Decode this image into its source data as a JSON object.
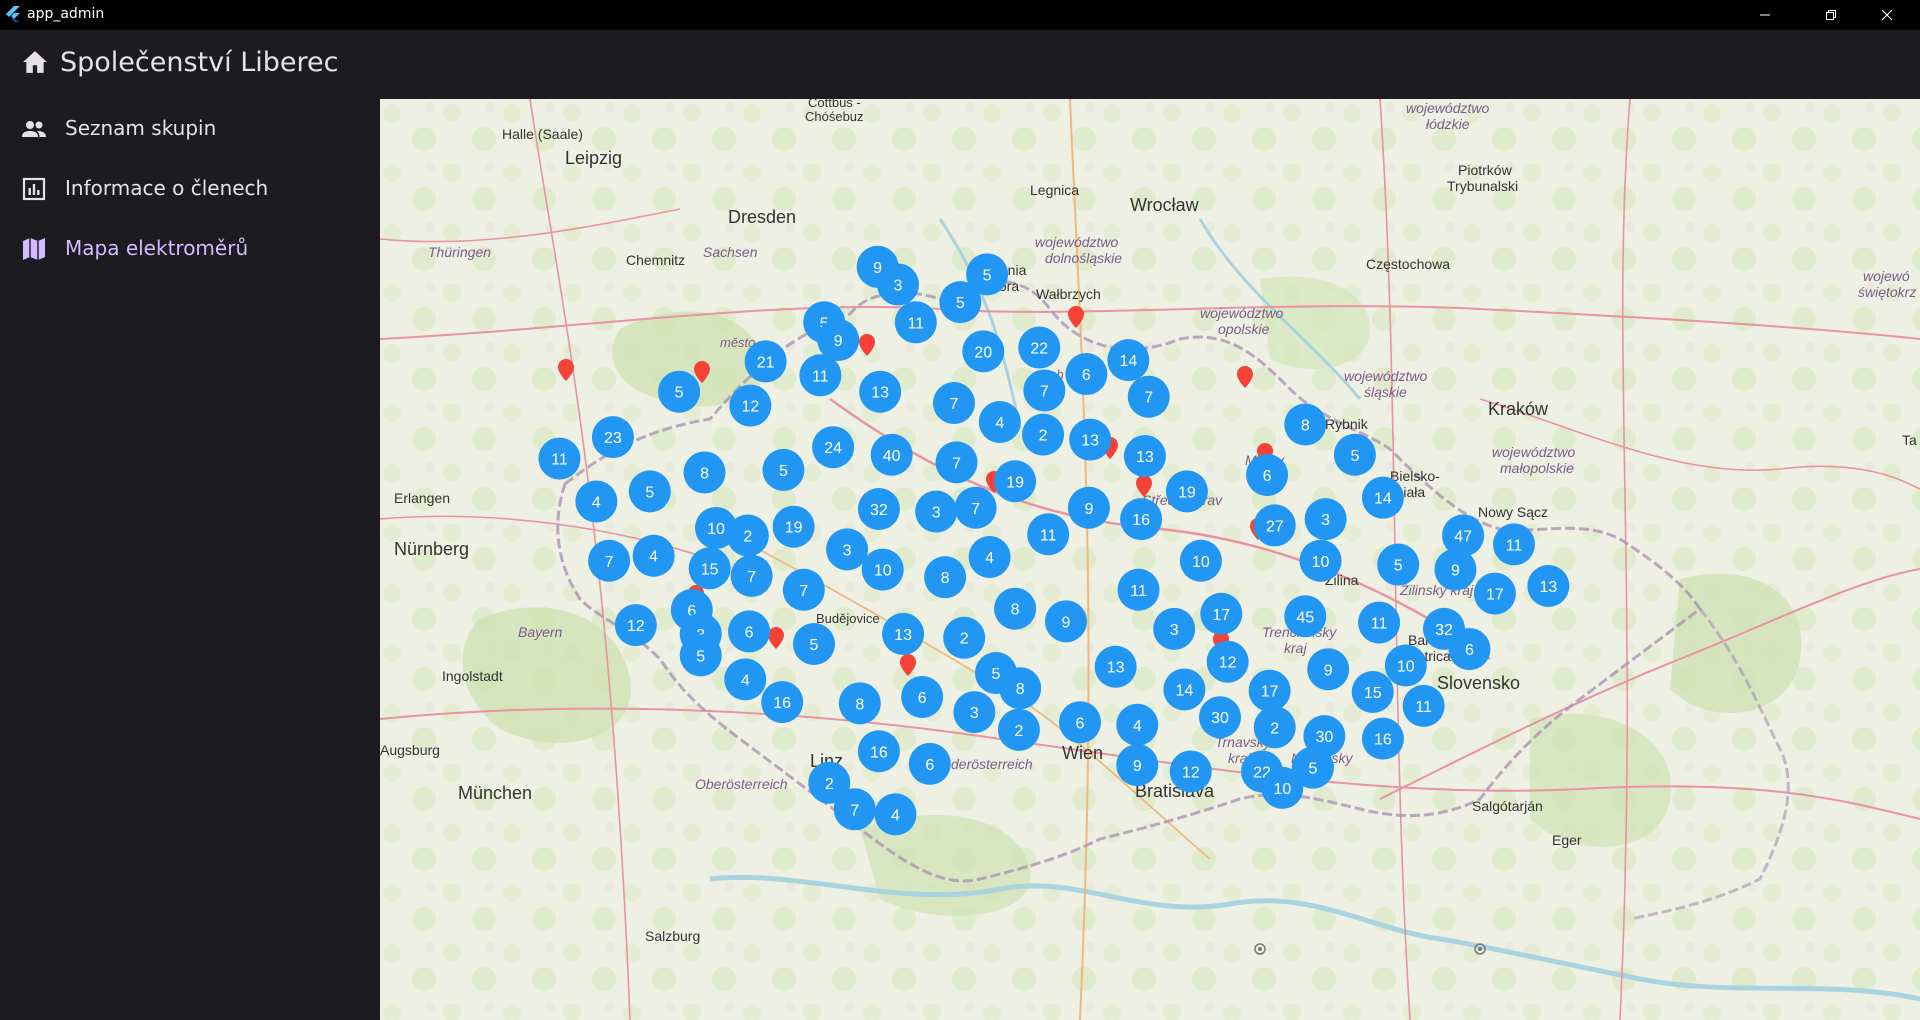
{
  "window": {
    "title": "app_admin",
    "controls": [
      "minimize-icon",
      "restore-icon",
      "close-icon"
    ]
  },
  "appbar": {
    "title": "Společenství Liberec",
    "icon": "home-icon"
  },
  "sidebar": {
    "items": [
      {
        "label": "Seznam skupin",
        "icon": "people-icon",
        "active": false
      },
      {
        "label": "Informace o členech",
        "icon": "bar-chart-icon",
        "active": false
      },
      {
        "label": "Mapa elektroměrů",
        "icon": "map-icon",
        "active": true
      }
    ]
  },
  "colors": {
    "accent": "#d0bcff",
    "cluster": "#2196f3",
    "marker": "#f44336",
    "background": "#1c1b1f"
  },
  "map": {
    "labels": {
      "halle": "Halle (Saale)",
      "leipzig": "Leipzig",
      "cottbus": "Cottbus -",
      "chosebuz": "Chóśebuz",
      "dresden": "Dresden",
      "sachsen": "Sachsen",
      "chemnitz": "Chemnitz",
      "thuringen": "Thüringen",
      "erlangen": "Erlangen",
      "nurnberg": "Nürnberg",
      "bayern": "Bayern",
      "ingolstadt": "Ingolstadt",
      "augsburg": "Augsburg",
      "munchen": "München",
      "salzburg": "Salzburg",
      "linz": "Linz",
      "oberosterreich": "Oberösterreich",
      "niederosterreich": "Niederösterreich",
      "wien": "Wien",
      "bratislava": "Bratislava",
      "legnica": "Legnica",
      "wroclaw": "Wrocław",
      "wojdolno1": "województwo",
      "wojdolno2": "dolnośląskie",
      "jelenia": "Jelenia",
      "gora": "Góra",
      "walbrzych": "Wałbrzych",
      "wojopol1": "województwo",
      "wojopol2": "opolskie",
      "wojslask1": "województwo",
      "wojslask2": "śląskie",
      "czestochowa": "Częstochowa",
      "piotrkow1": "Piotrków",
      "piotrkow2": "Trybunalski",
      "wojlodz1": "województwo",
      "wojlodz2": "łódzkie",
      "wojswiet1": "wojewó",
      "wojswiet2": "świętokrz",
      "krakow": "Kraków",
      "rybnik": "Rybnik",
      "wojmalo1": "województwo",
      "wojmalo2": "małopolskie",
      "bielsko1": "Bielsko-",
      "bielsko2": "Biała",
      "ta": "Ta",
      "nowysacz": "Nowy Sącz",
      "zilina": "Žilina",
      "zilinsky": "Žilinský kraj",
      "trencin1": "Trenčiansky",
      "trencin2": "kraj",
      "banska1": "Banská",
      "banska2": "Bystrica",
      "slovensko": "Slovensko",
      "trnava1": "Trnavský",
      "trnava2": "kraj",
      "nitra1": "Nitriansky",
      "nitra2": "kraj",
      "salgotarjan": "Salgótarján",
      "eger": "Eger",
      "stredomor": "Středomorav",
      "morav": "Morav",
      "budejovice": "Budějovice",
      "mesto": "město",
      "ch": "ch"
    },
    "clusters": [
      {
        "count": "9"
      },
      {
        "count": "3"
      },
      {
        "count": "5"
      },
      {
        "count": "5"
      },
      {
        "count": "11"
      },
      {
        "count": "5"
      },
      {
        "count": "9"
      },
      {
        "count": "21"
      },
      {
        "count": "11"
      },
      {
        "count": "20"
      },
      {
        "count": "22"
      },
      {
        "count": "14"
      },
      {
        "count": "6"
      },
      {
        "count": "7"
      },
      {
        "count": "7"
      },
      {
        "count": "13"
      },
      {
        "count": "5"
      },
      {
        "count": "12"
      },
      {
        "count": "7"
      },
      {
        "count": "4"
      },
      {
        "count": "2"
      },
      {
        "count": "13"
      },
      {
        "count": "23"
      },
      {
        "count": "11"
      },
      {
        "count": "24"
      },
      {
        "count": "40"
      },
      {
        "count": "5"
      },
      {
        "count": "8"
      },
      {
        "count": "5"
      },
      {
        "count": "4"
      },
      {
        "count": "7"
      },
      {
        "count": "19"
      },
      {
        "count": "13"
      },
      {
        "count": "8"
      },
      {
        "count": "5"
      },
      {
        "count": "32"
      },
      {
        "count": "3"
      },
      {
        "count": "7"
      },
      {
        "count": "10"
      },
      {
        "count": "2"
      },
      {
        "count": "19"
      },
      {
        "count": "9"
      },
      {
        "count": "16"
      },
      {
        "count": "19"
      },
      {
        "count": "6"
      },
      {
        "count": "14"
      },
      {
        "count": "7"
      },
      {
        "count": "4"
      },
      {
        "count": "15"
      },
      {
        "count": "7"
      },
      {
        "count": "3"
      },
      {
        "count": "10"
      },
      {
        "count": "8"
      },
      {
        "count": "4"
      },
      {
        "count": "11"
      },
      {
        "count": "27"
      },
      {
        "count": "3"
      },
      {
        "count": "10"
      },
      {
        "count": "5"
      },
      {
        "count": "47"
      },
      {
        "count": "11"
      },
      {
        "count": "9"
      },
      {
        "count": "17"
      },
      {
        "count": "13"
      },
      {
        "count": "6"
      },
      {
        "count": "7"
      },
      {
        "count": "12"
      },
      {
        "count": "6"
      },
      {
        "count": "3"
      },
      {
        "count": "5"
      },
      {
        "count": "13"
      },
      {
        "count": "2"
      },
      {
        "count": "8"
      },
      {
        "count": "9"
      },
      {
        "count": "11"
      },
      {
        "count": "10"
      },
      {
        "count": "45"
      },
      {
        "count": "17"
      },
      {
        "count": "3"
      },
      {
        "count": "11"
      },
      {
        "count": "32"
      },
      {
        "count": "6"
      },
      {
        "count": "5"
      },
      {
        "count": "4"
      },
      {
        "count": "16"
      },
      {
        "count": "13"
      },
      {
        "count": "12"
      },
      {
        "count": "9"
      },
      {
        "count": "10"
      },
      {
        "count": "8"
      },
      {
        "count": "6"
      },
      {
        "count": "5"
      },
      {
        "count": "8"
      },
      {
        "count": "3"
      },
      {
        "count": "2"
      },
      {
        "count": "14"
      },
      {
        "count": "17"
      },
      {
        "count": "15"
      },
      {
        "count": "11"
      },
      {
        "count": "6"
      },
      {
        "count": "30"
      },
      {
        "count": "2"
      },
      {
        "count": "4"
      },
      {
        "count": "30"
      },
      {
        "count": "16"
      },
      {
        "count": "16"
      },
      {
        "count": "6"
      },
      {
        "count": "2"
      },
      {
        "count": "9"
      },
      {
        "count": "12"
      },
      {
        "count": "22"
      },
      {
        "count": "5"
      },
      {
        "count": "10"
      },
      {
        "count": "7"
      },
      {
        "count": "4"
      }
    ]
  }
}
